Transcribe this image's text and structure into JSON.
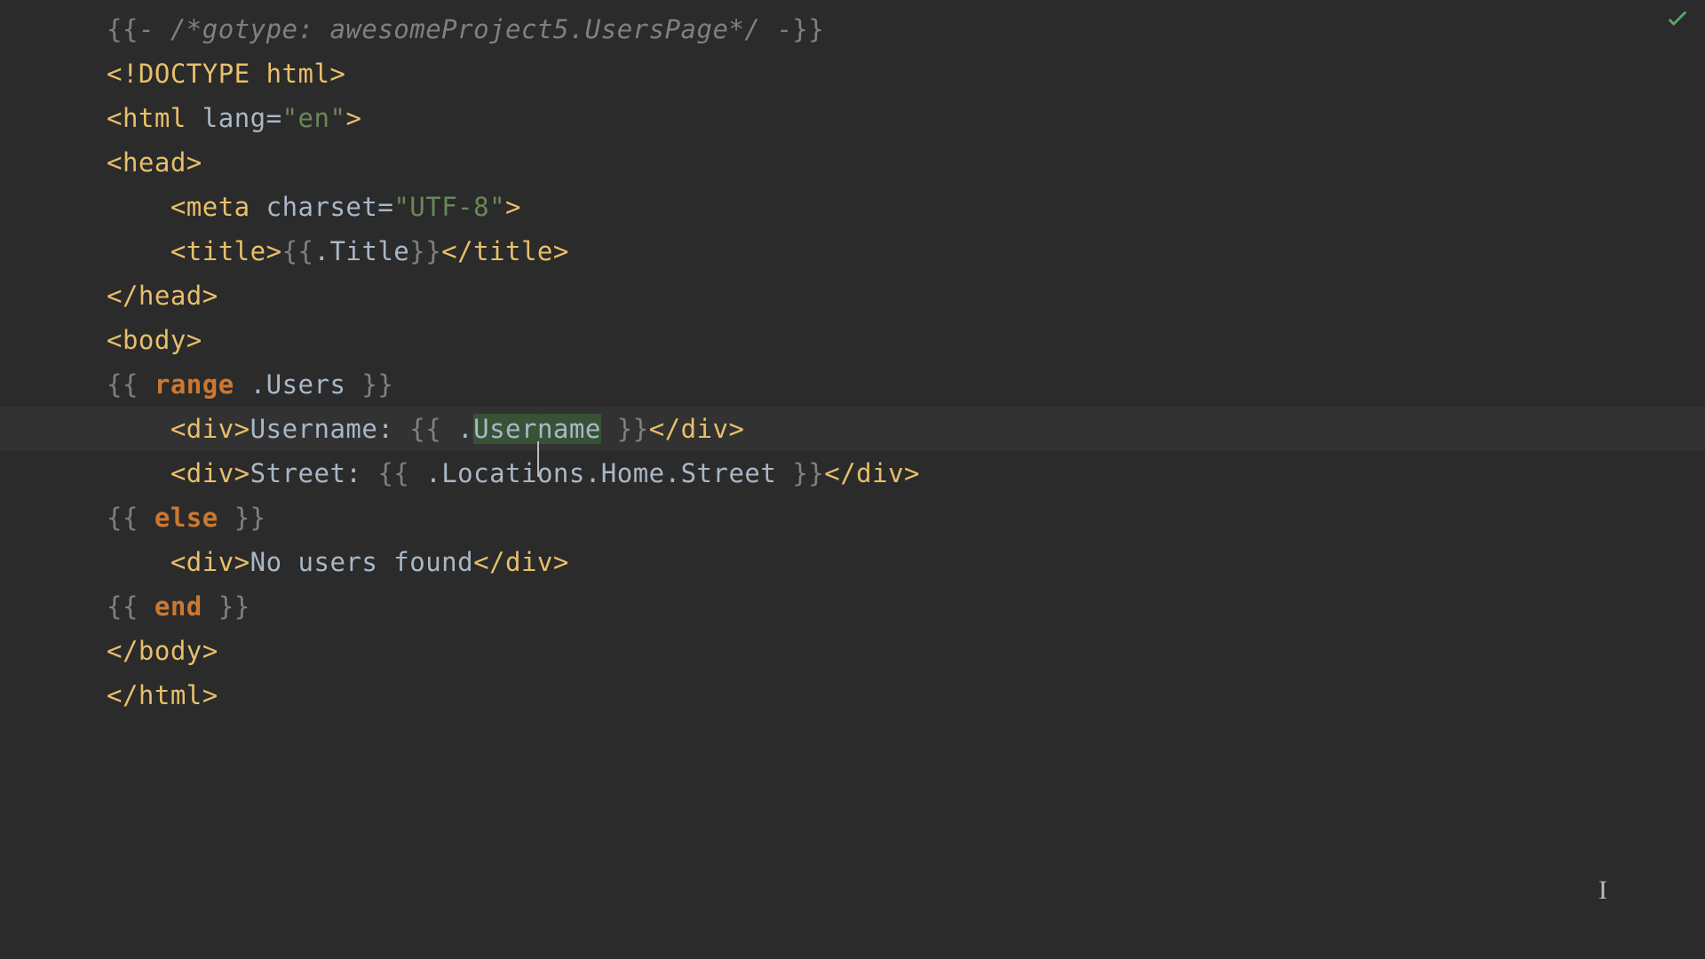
{
  "lines": {
    "l1": {
      "open": "{{- ",
      "comment": "/*gotype: awesomeProject5.UsersPage*/",
      "close": " -}}"
    },
    "l2": {
      "doctype": "<!DOCTYPE html>"
    },
    "l3": {
      "open": "<html",
      "sp": " ",
      "attr": "lang=",
      "val": "\"en\"",
      "close": ">"
    },
    "l4": {
      "tag": "<head>"
    },
    "l5": {
      "indent": "    ",
      "open": "<meta",
      "sp": " ",
      "attr": "charset=",
      "val": "\"UTF-8\"",
      "close": ">"
    },
    "l6": {
      "indent": "    ",
      "open": "<title>",
      "tmplOpen": "{{",
      "expr": ".Title",
      "tmplClose": "}}",
      "close": "</title>"
    },
    "l7": {
      "tag": "</head>"
    },
    "l8": {
      "tag": "<body>"
    },
    "l9": {
      "tmplOpen": "{{ ",
      "kw": "range",
      "expr": " .Users ",
      "tmplClose": "}}"
    },
    "l10": {
      "indent": "    ",
      "open": "<div>",
      "label": "Username: ",
      "tmplOpen": "{{ ",
      "dot": ".",
      "wordA": "User",
      "wordB": "name",
      "sp": " ",
      "tmplClose": "}}",
      "close": "</div>"
    },
    "l11": {
      "indent": "    ",
      "open": "<div>",
      "label": "Street: ",
      "tmplOpen": "{{ ",
      "expr": ".Locations.Home.Street ",
      "tmplClose": "}}",
      "close": "</div>"
    },
    "l12": {
      "tmplOpen": "{{ ",
      "kw": "else",
      "sp": " ",
      "tmplClose": "}}"
    },
    "l13": {
      "indent": "    ",
      "open": "<div>",
      "text": "No users found",
      "close": "</div>"
    },
    "l14": {
      "tmplOpen": "{{ ",
      "kw": "end",
      "sp": " ",
      "tmplClose": "}}"
    },
    "l15": {
      "tag": "</body>"
    },
    "l16": {
      "tag": "</html>"
    }
  },
  "status": {
    "ok": true,
    "okColor": "#59a869"
  }
}
